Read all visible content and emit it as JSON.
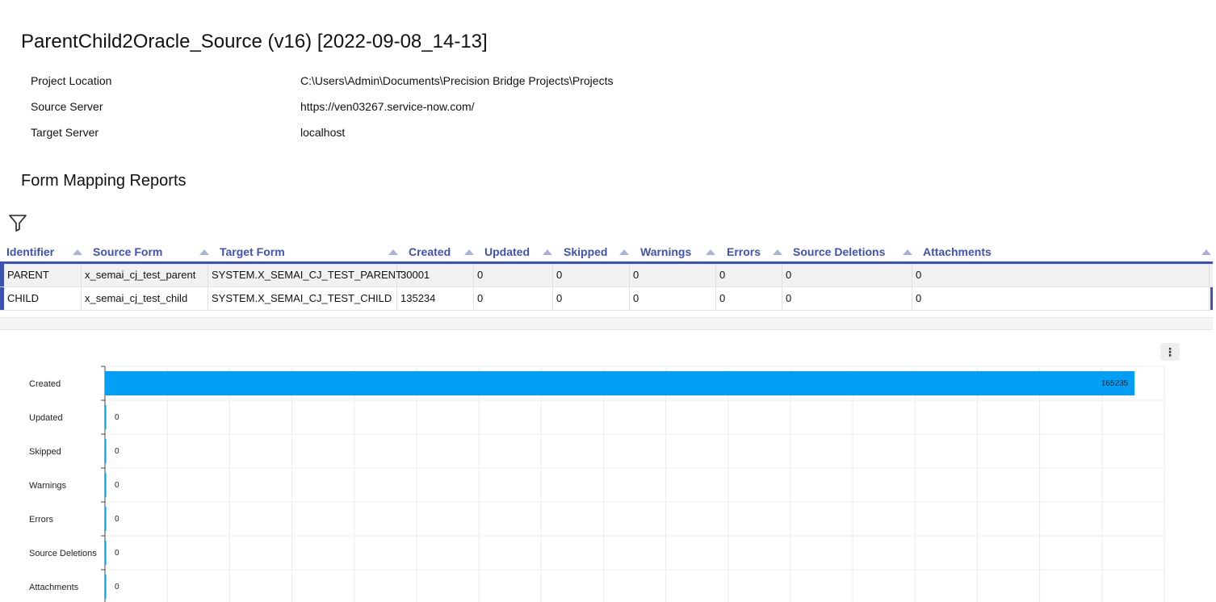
{
  "report": {
    "title": "ParentChild2Oracle_Source (v16) [2022-09-08_14-13]",
    "info": [
      {
        "label": "Project Location",
        "value": "C:\\Users\\Admin\\Documents\\Precision Bridge Projects\\Projects"
      },
      {
        "label": "Source Server",
        "value": "https://ven03267.service-now.com/"
      },
      {
        "label": "Target Server",
        "value": "localhost"
      }
    ],
    "section_title": "Form Mapping Reports",
    "filter_icon": "filter-icon"
  },
  "grid": {
    "columns": [
      "Identifier",
      "Source Form",
      "Target Form",
      "Created",
      "Updated",
      "Skipped",
      "Warnings",
      "Errors",
      "Source Deletions",
      "Attachments"
    ],
    "rows": [
      [
        "PARENT",
        "x_semai_cj_test_parent",
        "SYSTEM.X_SEMAI_CJ_TEST_PARENT",
        "30001",
        "0",
        "0",
        "0",
        "0",
        "0",
        "0"
      ],
      [
        "CHILD",
        "x_semai_cj_test_child",
        "SYSTEM.X_SEMAI_CJ_TEST_CHILD",
        "135234",
        "0",
        "0",
        "0",
        "0",
        "0",
        "0"
      ]
    ],
    "accent_color": "#3f51b5"
  },
  "chart_menu": {
    "label": "⋮",
    "icon": "more-vertical-icon"
  },
  "chart_data": {
    "type": "bar",
    "orientation": "horizontal",
    "categories": [
      "Created",
      "Updated",
      "Skipped",
      "Warnings",
      "Errors",
      "Source Deletions",
      "Attachments"
    ],
    "values": [
      165235,
      0,
      0,
      0,
      0,
      0,
      0
    ],
    "data_labels": [
      "165235",
      "0",
      "0",
      "0",
      "0",
      "0",
      "0"
    ],
    "bar_color": "#039ff4",
    "xlim": [
      0,
      170000
    ],
    "grid": true
  }
}
